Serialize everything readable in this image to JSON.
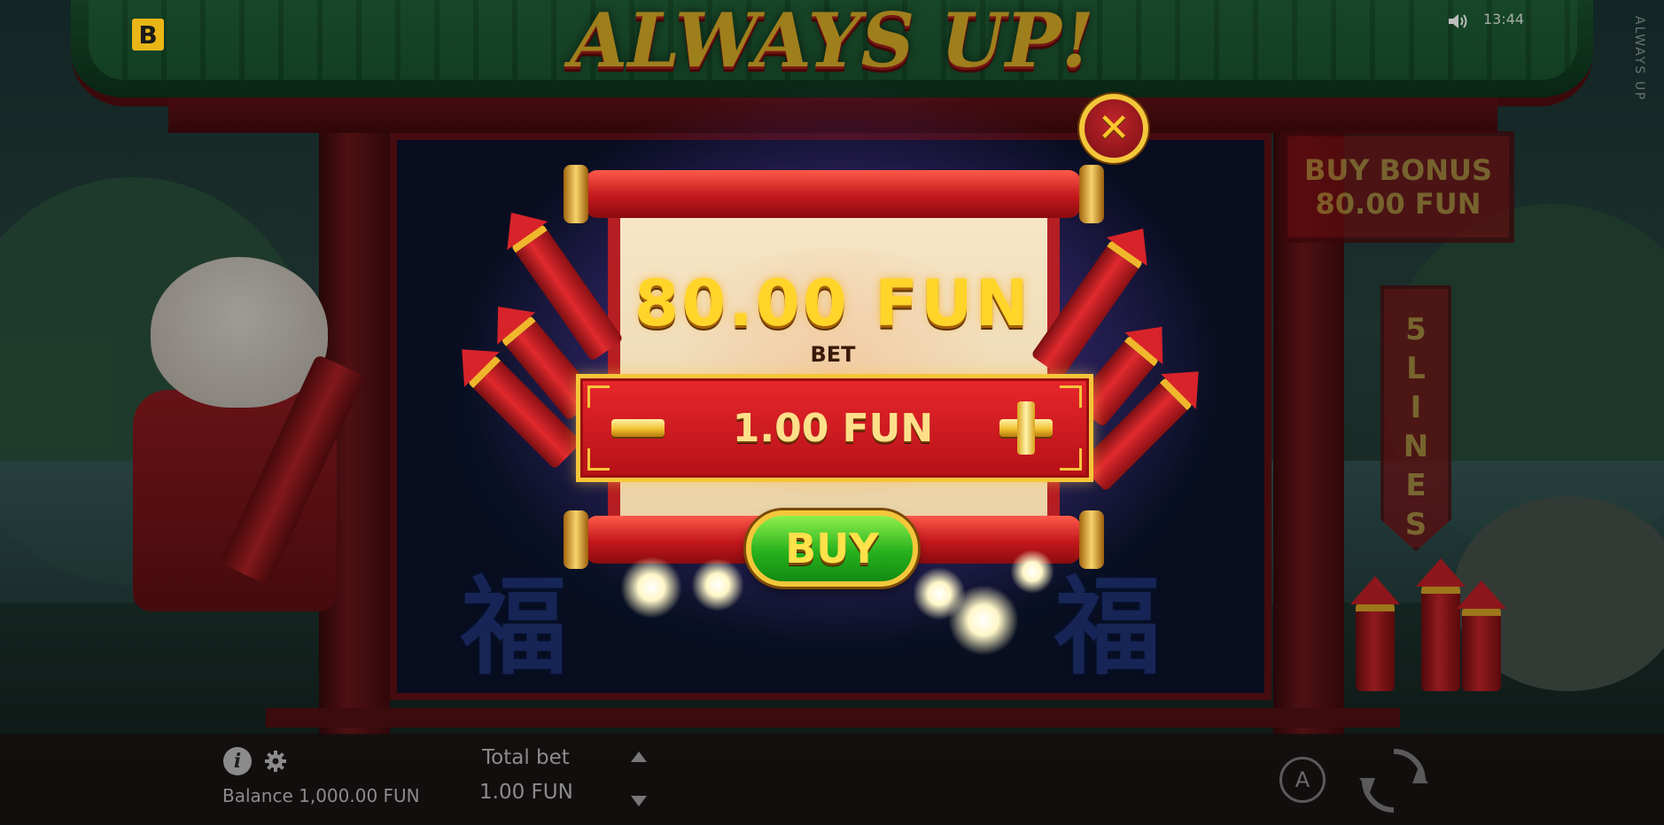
{
  "game": {
    "title": "ALWAYS UP!",
    "vertical_title": "ALWAYS UP",
    "logo_letter": "B",
    "clock": "13:44",
    "fu_char": "福"
  },
  "side": {
    "buy_bonus_line1": "BUY BONUS",
    "buy_bonus_line2": "80.00 FUN",
    "lines_letters": [
      "5",
      "L",
      "I",
      "N",
      "E",
      "S"
    ]
  },
  "modal": {
    "price": "80.00 FUN",
    "bet_label": "BET",
    "bet_value": "1.00 FUN",
    "buy_label": "BUY",
    "close_glyph": "✕"
  },
  "bottom_bar": {
    "info_glyph": "i",
    "balance": "Balance 1,000.00 FUN",
    "total_bet_label": "Total bet",
    "total_bet_value": "1.00 FUN",
    "auto_label": "A"
  },
  "icons": [
    "logo-icon",
    "sound-icon",
    "close-icon",
    "minus-icon",
    "plus-icon",
    "info-icon",
    "gear-icon",
    "arrow-up-icon",
    "arrow-down-icon",
    "autoplay-icon",
    "spin-icon"
  ],
  "colors": {
    "accent_gold": "#f5c53a",
    "panel_red": "#d3191f",
    "buy_green": "#27b11c",
    "modal_glow": "#aa78ff"
  }
}
